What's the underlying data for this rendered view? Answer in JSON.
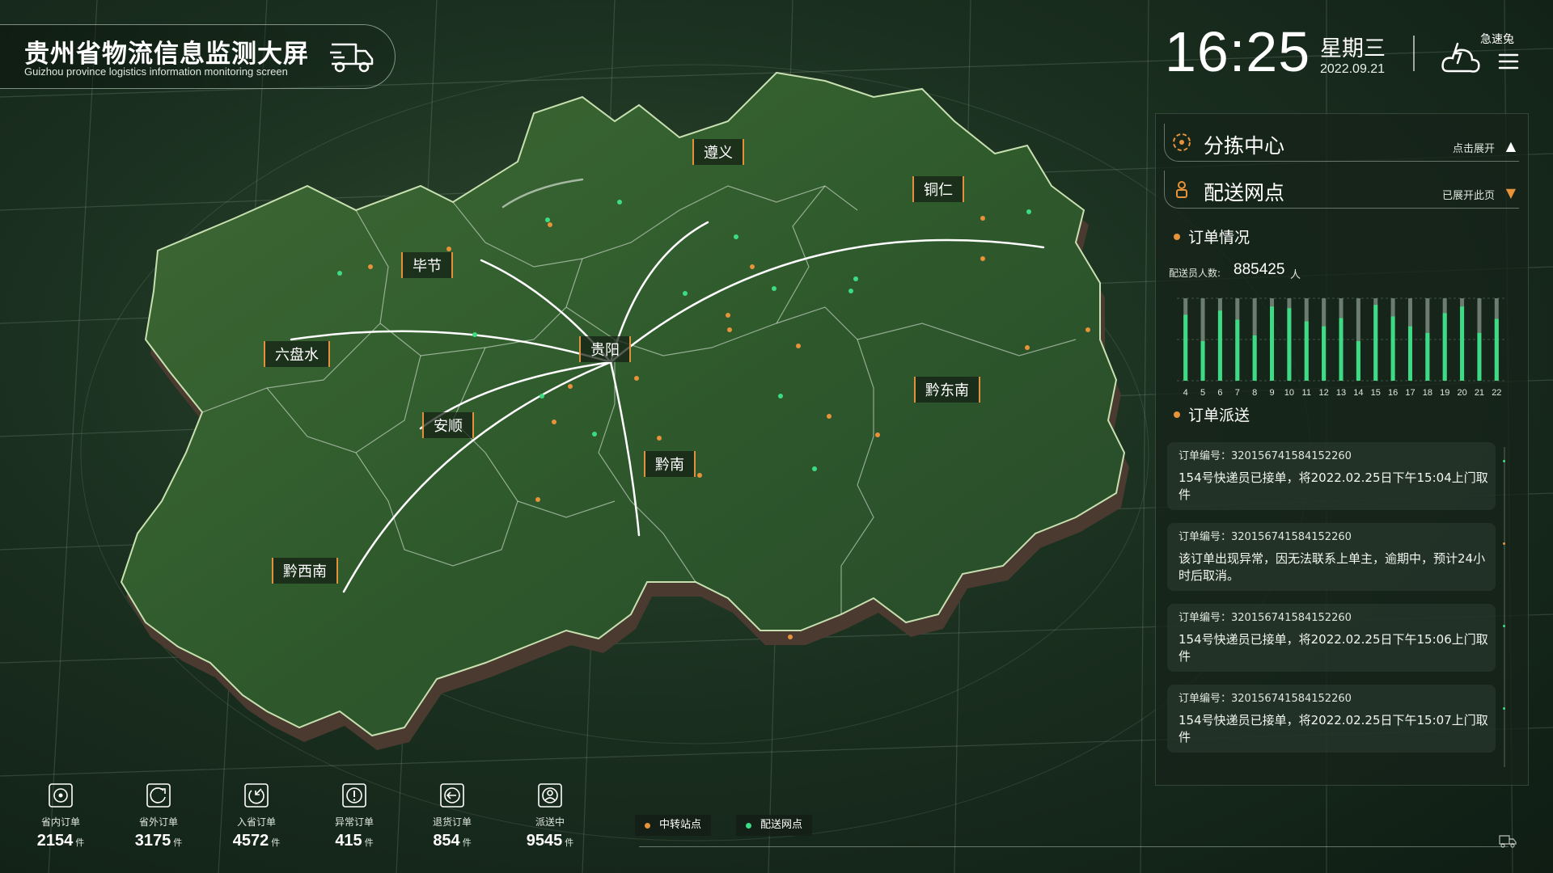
{
  "header": {
    "title": "贵州省物流信息监测大屏",
    "subtitle": "Guizhou province logistics information monitoring screen",
    "time": "16:25",
    "weekday": "星期三",
    "date": "2022.09.21",
    "weather": "急速兔",
    "icons": [
      "truck-icon",
      "weather-icon",
      "menu-icon"
    ]
  },
  "map": {
    "cities": {
      "zunyi": "遵义",
      "tongren": "铜仁",
      "bijie": "毕节",
      "liupanshui": "六盘水",
      "guiyang": "贵阳",
      "anshun": "安顺",
      "qiandongnan": "黔东南",
      "qiannan": "黔南",
      "qianxinan": "黔西南"
    },
    "colors": {
      "route": "#ffffff",
      "transfer": "#e8923a",
      "delivery": "#3ddc84",
      "label_border": "#e2903a"
    }
  },
  "panel": {
    "sorting": {
      "title": "分拣中心",
      "action": "点击展开",
      "arrow": "▲"
    },
    "delivery": {
      "title": "配送网点",
      "action": "已展开此页",
      "arrow": "▼"
    },
    "orders": {
      "title": "订单情况",
      "count_label": "配送员人数:",
      "count_value": "885425",
      "count_unit": "人"
    },
    "dispatch": {
      "title": "订单派送",
      "items": [
        {
          "id": "订单编号：320156741584152260",
          "msg": "154号快递员已接单，将2022.02.25日下午15:04上门取件"
        },
        {
          "id": "订单编号：320156741584152260",
          "msg": "该订单出现异常，因无法联系上单主，逾期中，预计24小时后取消。"
        },
        {
          "id": "订单编号：320156741584152260",
          "msg": "154号快递员已接单，将2022.02.25日下午15:06上门取件"
        },
        {
          "id": "订单编号：320156741584152260",
          "msg": "154号快递员已接单，将2022.02.25日下午15:07上门取件"
        }
      ]
    }
  },
  "stats": [
    {
      "label": "省内订单",
      "value": "2154",
      "unit": "件",
      "icon": "target-icon"
    },
    {
      "label": "省外订单",
      "value": "3175",
      "unit": "件",
      "icon": "export-icon"
    },
    {
      "label": "入省订单",
      "value": "4572",
      "unit": "件",
      "icon": "import-icon"
    },
    {
      "label": "异常订单",
      "value": "415",
      "unit": "件",
      "icon": "alert-icon"
    },
    {
      "label": "退货订单",
      "value": "854",
      "unit": "件",
      "icon": "return-icon"
    },
    {
      "label": "派送中",
      "value": "9545",
      "unit": "件",
      "icon": "courier-icon"
    }
  ],
  "legend": [
    {
      "label": "中转站点",
      "color": "#e8923a"
    },
    {
      "label": "配送网点",
      "color": "#3ddc84"
    }
  ],
  "chart_data": {
    "type": "bar",
    "categories": [
      "4",
      "5",
      "6",
      "7",
      "8",
      "9",
      "10",
      "11",
      "12",
      "13",
      "14",
      "15",
      "16",
      "17",
      "18",
      "19",
      "20",
      "21",
      "22"
    ],
    "series": [
      {
        "values": [
          80,
          48,
          85,
          74,
          55,
          90,
          88,
          72,
          66,
          76,
          48,
          92,
          78,
          66,
          58,
          82,
          90,
          58,
          75
        ]
      },
      {
        "values": [
          100,
          100,
          100,
          100,
          100,
          100,
          100,
          100,
          100,
          100,
          100,
          100,
          100,
          100,
          100,
          100,
          100,
          100,
          100
        ]
      }
    ],
    "ylim": [
      0,
      100
    ],
    "grid": true,
    "colors": [
      "#3ddc84",
      "#6a7d6e"
    ]
  }
}
